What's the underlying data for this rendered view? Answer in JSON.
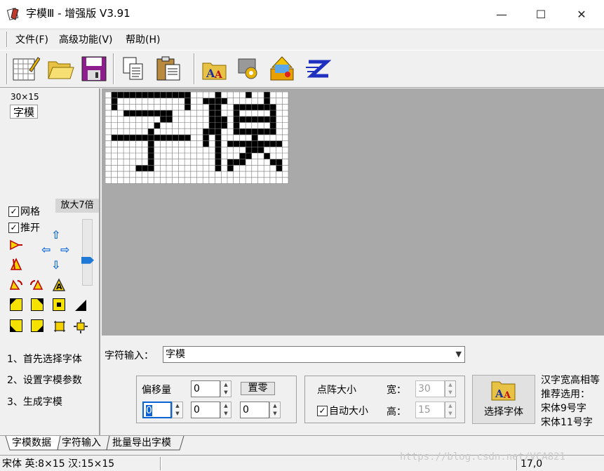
{
  "window": {
    "title": "字模Ⅲ - 增强版 V3.91",
    "controls": {
      "minimize": "—",
      "maximize": "☐",
      "close": "✕"
    }
  },
  "menu": [
    {
      "label": "文件(F)"
    },
    {
      "label": "高级功能(V)"
    },
    {
      "label": "帮助(H)"
    }
  ],
  "toolbar": {
    "icons": [
      "new-grid-icon",
      "open-folder-icon",
      "save-disk-icon",
      "copy-icon",
      "paste-icon",
      "font-icon",
      "settings-icon",
      "export-icon",
      "z-icon"
    ]
  },
  "left_panel": {
    "size_label": "30×15",
    "preview_text": "字模",
    "grid_checkbox": {
      "label": "网格",
      "checked": true
    },
    "push_checkbox": {
      "label": "推开",
      "checked": true
    },
    "zoom_label": "放大7倍",
    "zoom_level_fraction": 0.68,
    "arrows": {
      "up": "⇧",
      "left": "⇦",
      "right": "⇨",
      "down": "⇩"
    }
  },
  "glyph": {
    "text": "字模",
    "cols": 30,
    "rows": 15
  },
  "bottom": {
    "steps": [
      "1、首先选择字体",
      "2、设置字模参数",
      "3、生成字模"
    ],
    "char_input_label": "字符输入：",
    "char_input_value": "字模",
    "offset_label": "偏移量",
    "offset_top_value": "0",
    "reset_button": "置零",
    "offset_values": [
      "0",
      "0",
      "0"
    ],
    "dot_size_label": "点阵大小",
    "auto_size_label": "自动大小",
    "auto_size_checked": true,
    "width_label": "宽：",
    "width_value": "30",
    "height_label": "高：",
    "height_value": "15",
    "select_font_button": "选择字体",
    "hint_lines": [
      "汉字宽高相等",
      "推荐选用：",
      "宋体9号字",
      "宋体11号字"
    ]
  },
  "tabs": [
    {
      "label": "字模数据"
    },
    {
      "label": "字符输入"
    },
    {
      "label": "批量导出字模"
    }
  ],
  "status": {
    "font_info": "宋体 英:8×15 汉:15×15",
    "coords": "17,0"
  },
  "watermark": "https://blog.csdn.net/VCA821"
}
